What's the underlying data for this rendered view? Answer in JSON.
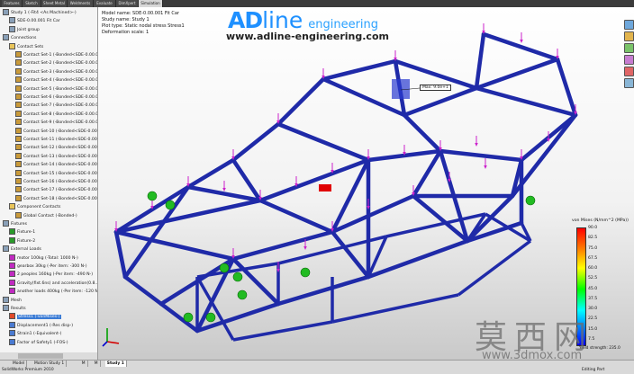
{
  "ribbon": {
    "tabs": [
      "Features",
      "Sketch",
      "Sheet Metal",
      "Weldments",
      "Evaluate",
      "DimXpert",
      "Simulation"
    ],
    "active": "Simulation"
  },
  "tree": {
    "items": [
      {
        "label": "Study 1 (-Fit4 <As Machined>-)",
        "level": 0,
        "icon": "study-icon"
      },
      {
        "label": "SDE-0.00.001 Fit Car",
        "level": 1,
        "icon": "part-icon"
      },
      {
        "label": "Joint group",
        "level": 1,
        "icon": "joint-icon"
      },
      {
        "label": "Connections",
        "level": 0,
        "icon": "connections-icon"
      },
      {
        "label": "Contact Sets",
        "level": 1,
        "icon": "folder-icon"
      },
      {
        "label": "Contact Set-1 (-Bonded<SDE-0.00.00...",
        "level": 2,
        "icon": "contact-icon"
      },
      {
        "label": "Contact Set-2 (-Bonded<SDE-0.00.00...",
        "level": 2,
        "icon": "contact-icon"
      },
      {
        "label": "Contact Set-3 (-Bonded<SDE-0.00.00...",
        "level": 2,
        "icon": "contact-icon"
      },
      {
        "label": "Contact Set-4 (-Bonded<SDE-0.00.00...",
        "level": 2,
        "icon": "contact-icon"
      },
      {
        "label": "Contact Set-5 (-Bonded<SDE-0.00.00...",
        "level": 2,
        "icon": "contact-icon"
      },
      {
        "label": "Contact Set-6 (-Bonded<SDE-0.00.00...",
        "level": 2,
        "icon": "contact-icon"
      },
      {
        "label": "Contact Set-7 (-Bonded<SDE-0.00.00...",
        "level": 2,
        "icon": "contact-icon"
      },
      {
        "label": "Contact Set-8 (-Bonded<SDE-0.00.00...",
        "level": 2,
        "icon": "contact-icon"
      },
      {
        "label": "Contact Set-9 (-Bonded<SDE-0.00.00...",
        "level": 2,
        "icon": "contact-icon"
      },
      {
        "label": "Contact Set-10 (-Bonded<SDE-0.00.0...",
        "level": 2,
        "icon": "contact-icon"
      },
      {
        "label": "Contact Set-11 (-Bonded<SDE-0.00.0...",
        "level": 2,
        "icon": "contact-icon"
      },
      {
        "label": "Contact Set-12 (-Bonded<SDE-0.00.0...",
        "level": 2,
        "icon": "contact-icon"
      },
      {
        "label": "Contact Set-13 (-Bonded<SDE-0.00.0...",
        "level": 2,
        "icon": "contact-icon"
      },
      {
        "label": "Contact Set-14 (-Bonded<SDE-0.00.0...",
        "level": 2,
        "icon": "contact-icon"
      },
      {
        "label": "Contact Set-15 (-Bonded<SDE-0.00.0...",
        "level": 2,
        "icon": "contact-icon"
      },
      {
        "label": "Contact Set-16 (-Bonded<SDE-0.00.0...",
        "level": 2,
        "icon": "contact-icon"
      },
      {
        "label": "Contact Set-17 (-Bonded<SDE-0.00.0...",
        "level": 2,
        "icon": "contact-icon"
      },
      {
        "label": "Contact Set-18 (-Bonded<SDE-0.00.0...",
        "level": 2,
        "icon": "contact-icon"
      },
      {
        "label": "Component Contacts",
        "level": 1,
        "icon": "folder-icon"
      },
      {
        "label": "Global Contact (-Bonded-)",
        "level": 2,
        "icon": "contact-icon"
      },
      {
        "label": "Fixtures",
        "level": 0,
        "icon": "fixtures-icon"
      },
      {
        "label": "Fixture-1",
        "level": 1,
        "icon": "fixture-icon"
      },
      {
        "label": "Fixture-2",
        "level": 1,
        "icon": "fixture-icon"
      },
      {
        "label": "External Loads",
        "level": 0,
        "icon": "loads-icon"
      },
      {
        "label": "motor 100kg (-Total: 1000 N-)",
        "level": 1,
        "icon": "force-icon"
      },
      {
        "label": "gearbox 30kg (-Per item: -300 N-)",
        "level": 1,
        "icon": "force-icon"
      },
      {
        "label": "2 peoples 160kg (-Per item: -490 N-)",
        "level": 1,
        "icon": "force-icon"
      },
      {
        "label": "Gravity(fixt.6ns) and acceleration(0.8...",
        "level": 1,
        "icon": "gravity-icon"
      },
      {
        "label": "another loads 400kg (-Per item: -120 N...",
        "level": 1,
        "icon": "force-icon"
      },
      {
        "label": "Mesh",
        "level": 0,
        "icon": "mesh-icon"
      },
      {
        "label": "Results",
        "level": 0,
        "icon": "results-icon"
      },
      {
        "label": "Stress1 (-vonMises-)",
        "level": 1,
        "icon": "stress-icon",
        "selected": true
      },
      {
        "label": "Displacement1 (-Res disp-)",
        "level": 1,
        "icon": "plot-icon"
      },
      {
        "label": "Strain1 (-Equivalent-)",
        "level": 1,
        "icon": "plot-icon"
      },
      {
        "label": "Factor of Safety1 (-FOS-)",
        "level": 1,
        "icon": "plot-icon"
      }
    ]
  },
  "viewport": {
    "info": [
      "Model name: SDE-0.00.001 Fit Car",
      "Study name: Study 1",
      "Plot type: Static nodal stress Stress1",
      "Deformation scale: 1"
    ],
    "brand": {
      "ad": "AD",
      "line": "line",
      "eng": "engineering",
      "url": "www.adline-engineering.com"
    },
    "probe_label": "Max: 9.0e+1",
    "legend": {
      "title": "von Mises (N/mm^2 (MPa))",
      "ticks": [
        "90.0",
        "82.5",
        "75.0",
        "67.5",
        "60.0",
        "52.5",
        "45.0",
        "37.5",
        "30.0",
        "22.5",
        "15.0",
        "7.5"
      ],
      "footer": "Yield strength: 235.0"
    },
    "watermark": {
      "chars": "莫西网",
      "url": "www.3dmox.com"
    }
  },
  "bottom": {
    "tabs": [
      "Model",
      "Motion Study 1",
      "M",
      "M",
      "Study 1"
    ],
    "active": "Study 1",
    "status_left": "SolidWorks Premium 2010",
    "status_right": "Editing Part"
  },
  "colors": {
    "brand": "#1e90ff",
    "frame": "#1f2aa8",
    "load_arrow": "#cc22cc",
    "fixture": "#22bb22",
    "selection": "#3a7bd5"
  }
}
